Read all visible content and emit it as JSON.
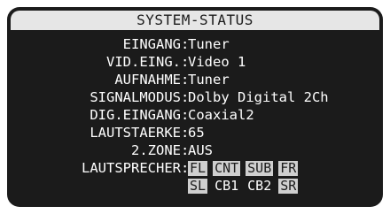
{
  "title": "SYSTEM-STATUS",
  "rows": [
    {
      "label": "EINGANG",
      "value": "Tuner"
    },
    {
      "label": "VID.EING.",
      "value": "Video 1"
    },
    {
      "label": "AUFNAHME",
      "value": "Tuner"
    },
    {
      "label": "SIGNALMODUS",
      "value": "Dolby Digital 2Ch"
    },
    {
      "label": "DIG.EINGANG",
      "value": "Coaxial2"
    },
    {
      "label": "LAUTSTAERKE",
      "value": "65"
    },
    {
      "label": "2.ZONE",
      "value": "AUS"
    }
  ],
  "speakers": {
    "label": "LAUTSPRECHER",
    "row1": [
      {
        "name": "FL",
        "active": true
      },
      {
        "name": "CNT",
        "active": true
      },
      {
        "name": "SUB",
        "active": true
      },
      {
        "name": "FR",
        "active": true
      }
    ],
    "row2": [
      {
        "name": "SL",
        "active": true
      },
      {
        "name": "CB1",
        "active": false
      },
      {
        "name": "CB2",
        "active": false
      },
      {
        "name": "SR",
        "active": true
      }
    ]
  },
  "colors": {
    "screen_bg": "#1b1b1b",
    "title_bg": "#e6e6e6",
    "text": "#ffffff",
    "active_speaker_bg": "#cfcfcf"
  }
}
